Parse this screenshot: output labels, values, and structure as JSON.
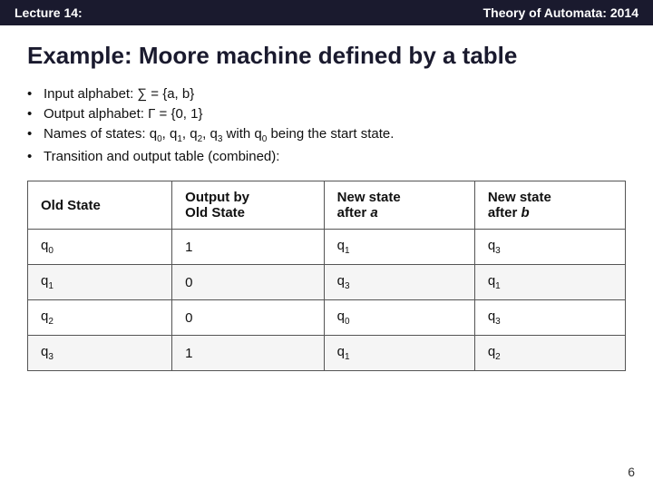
{
  "header": {
    "lecture": "Lecture 14:",
    "theory": "Theory of Automata: 2014"
  },
  "slide": {
    "title": "Example: Moore machine defined by a table"
  },
  "bullets": [
    "Input alphabet: ∑ = {a, b}",
    "Output alphabet: Γ = {0, 1}",
    "Names of states: q₀, q₁, q₂, q₃ with q₀ being the start state.",
    "Transition and output table (combined):"
  ],
  "table": {
    "headers": [
      "Old State",
      "Output by Old State",
      "New state after a",
      "New state after b"
    ],
    "rows": [
      [
        "q₀",
        "1",
        "q₁",
        "q₃"
      ],
      [
        "q₁",
        "0",
        "q₃",
        "q₁"
      ],
      [
        "q₂",
        "0",
        "q₀",
        "q₃"
      ],
      [
        "q₃",
        "1",
        "q₁",
        "q₂"
      ]
    ]
  },
  "page_number": "6"
}
